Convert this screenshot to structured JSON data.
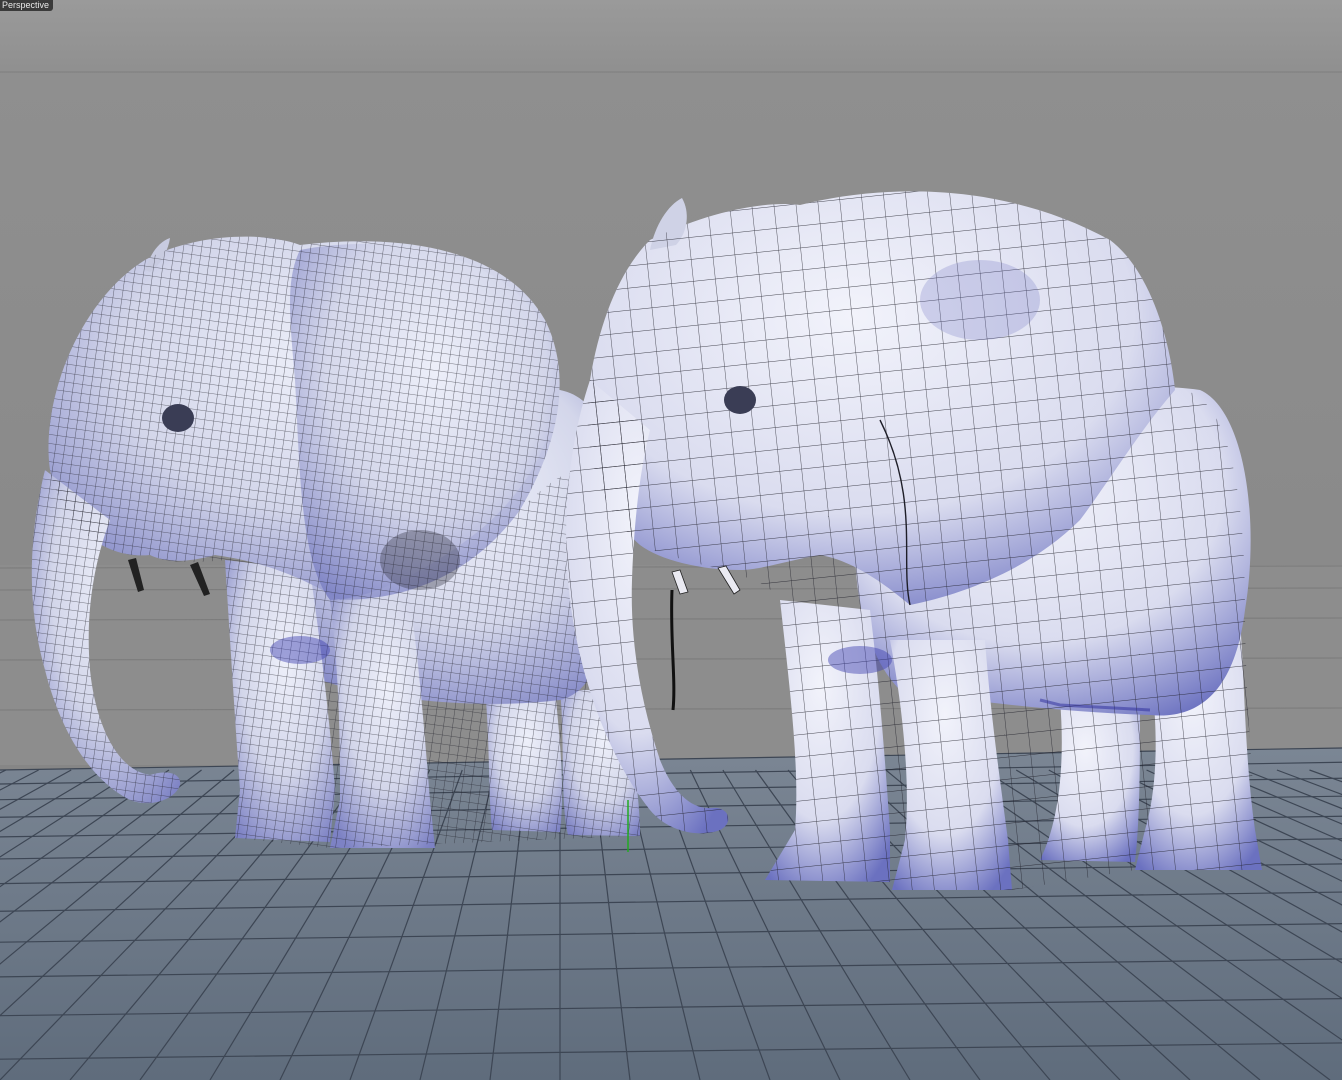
{
  "viewport": {
    "label": "Perspective",
    "background_color": "#8c8c8c",
    "floor_color": "#6d7a88",
    "grid_color": "#3d4654",
    "mesh_fill": "#e4e6f2",
    "mesh_shadow": "#5c63b8",
    "wire_color": "#1e1e28"
  },
  "scene": {
    "objects": [
      {
        "name": "elephant-dense-mesh",
        "wireframe": "dense"
      },
      {
        "name": "elephant-low-poly",
        "wireframe": "coarse"
      }
    ],
    "axis_colors": {
      "y": "#22aa22",
      "x": "#aa2222"
    }
  }
}
